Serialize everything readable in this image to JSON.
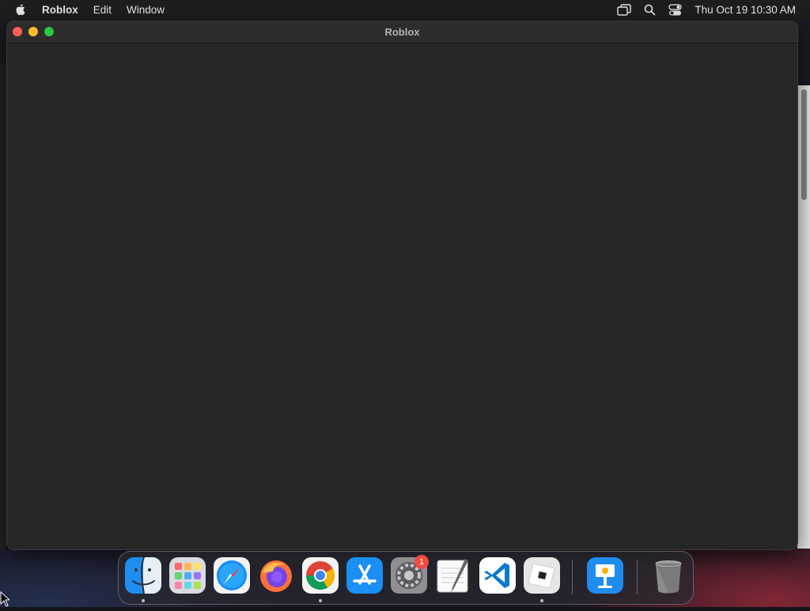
{
  "menubar": {
    "app_name": "Roblox",
    "menus": [
      "Edit",
      "Window"
    ],
    "clock": "Thu Oct 19  10:30 AM",
    "status_icons": [
      "screen-mirroring-icon",
      "spotlight-search-icon",
      "control-center-icon"
    ]
  },
  "window": {
    "title": "Roblox"
  },
  "dock": {
    "apps": [
      {
        "name": "Finder",
        "icon": "finder-icon",
        "running": true
      },
      {
        "name": "Launchpad",
        "icon": "launchpad-icon",
        "running": false
      },
      {
        "name": "Safari",
        "icon": "safari-icon",
        "running": false
      },
      {
        "name": "Firefox",
        "icon": "firefox-icon",
        "running": false
      },
      {
        "name": "Google Chrome",
        "icon": "chrome-icon",
        "running": true
      },
      {
        "name": "App Store",
        "icon": "app-store-icon",
        "running": false
      },
      {
        "name": "System Settings",
        "icon": "system-settings-icon",
        "running": false,
        "badge": "1"
      },
      {
        "name": "TextEdit",
        "icon": "textedit-icon",
        "running": false
      },
      {
        "name": "Visual Studio Code",
        "icon": "vscode-icon",
        "running": false
      },
      {
        "name": "Roblox",
        "icon": "roblox-icon",
        "running": true
      },
      {
        "name": "Keynote",
        "icon": "keynote-icon",
        "running": false
      },
      {
        "name": "Trash",
        "icon": "trash-icon",
        "running": false
      }
    ]
  }
}
